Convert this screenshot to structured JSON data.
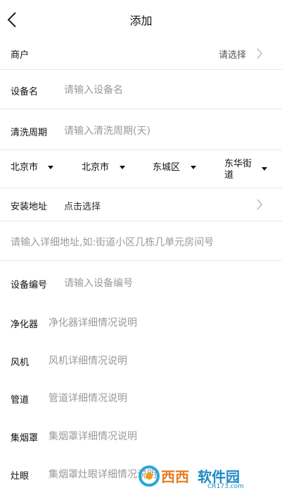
{
  "header": {
    "title": "添加"
  },
  "form": {
    "merchant": {
      "label": "商户",
      "value": "请选择"
    },
    "device_name": {
      "label": "设备名",
      "placeholder": "请输入设备名"
    },
    "clean_cycle": {
      "label": "清洗周期",
      "placeholder": "请输入清洗周期(天)"
    },
    "region": {
      "province": "北京市",
      "city": "北京市",
      "district": "东城区",
      "street_line1": "东华街",
      "street_line2": "道"
    },
    "install_address": {
      "label": "安装地址",
      "value": "点击选择"
    },
    "detail_address": {
      "placeholder": "请输入详细地址,如:街道小区几栋几单元房间号"
    },
    "device_number": {
      "label": "设备编号",
      "placeholder": "请输入设备编号"
    },
    "purifier": {
      "label": "净化器",
      "placeholder": "净化器详细情况说明"
    },
    "fan": {
      "label": "风机",
      "placeholder": "风机详细情况说明"
    },
    "duct": {
      "label": "管道",
      "placeholder": "管道详细情况说明"
    },
    "hood": {
      "label": "集烟罩",
      "placeholder": "集烟罩详细情况说明"
    },
    "stove_eye": {
      "label": "灶眼",
      "placeholder": "集烟罩灶眼详细情况说明"
    }
  },
  "watermark": {
    "brand": "西西",
    "name": "软件园",
    "url": "CR173.com"
  }
}
